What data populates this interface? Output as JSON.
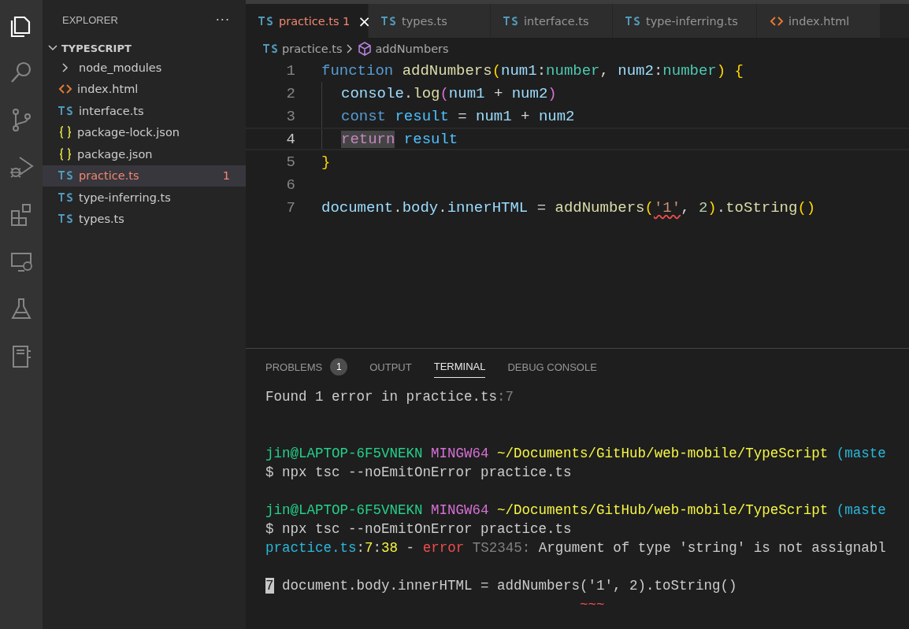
{
  "activity_bar": [
    {
      "kind": "files",
      "selected": true
    },
    {
      "kind": "search",
      "selected": false
    },
    {
      "kind": "branch",
      "selected": false
    },
    {
      "kind": "debug",
      "selected": false
    },
    {
      "kind": "extensions",
      "selected": false
    },
    {
      "kind": "remote",
      "selected": false
    },
    {
      "kind": "flask",
      "selected": false
    },
    {
      "kind": "notebook",
      "selected": false
    }
  ],
  "sidebar": {
    "title": "EXPLORER",
    "more": "···",
    "folder": {
      "label": "TYPESCRIPT",
      "expanded": true,
      "children": [
        {
          "label": "node_modules",
          "kind": "folder",
          "expanded": false,
          "selected": false,
          "error": false
        },
        {
          "label": "index.html",
          "kind": "html",
          "selected": false,
          "error": false
        },
        {
          "label": "interface.ts",
          "kind": "ts",
          "selected": false,
          "error": false
        },
        {
          "label": "package-lock.json",
          "kind": "json",
          "selected": false,
          "error": false
        },
        {
          "label": "package.json",
          "kind": "json",
          "selected": false,
          "error": false
        },
        {
          "label": "practice.ts",
          "kind": "ts",
          "selected": true,
          "error": true,
          "badge": "1"
        },
        {
          "label": "type-inferring.ts",
          "kind": "ts",
          "selected": false,
          "error": false
        },
        {
          "label": "types.ts",
          "kind": "ts",
          "selected": false,
          "error": false
        }
      ]
    }
  },
  "tabs": [
    {
      "label": "practice.ts",
      "kind": "ts",
      "selected": true,
      "error": true,
      "badge": "1",
      "close": "×"
    },
    {
      "label": "types.ts",
      "kind": "ts",
      "selected": false,
      "error": false
    },
    {
      "label": "interface.ts",
      "kind": "ts",
      "selected": false,
      "error": false
    },
    {
      "label": "type-inferring.ts",
      "kind": "ts",
      "selected": false,
      "error": false
    },
    {
      "label": "index.html",
      "kind": "html",
      "selected": false,
      "error": false
    }
  ],
  "breadcrumb": [
    {
      "label": "practice.ts",
      "kind": "ts"
    },
    {
      "label": "addNumbers",
      "kind": "symbol"
    }
  ],
  "editor": {
    "lines": [
      {
        "number": "1",
        "current": false,
        "indented": false,
        "tokens": [
          {
            "text": "function ",
            "kind": "keyword"
          },
          {
            "text": "addNumbers",
            "kind": "function"
          },
          {
            "text": "(",
            "kind": "bracket1"
          },
          {
            "text": "num1",
            "kind": "param"
          },
          {
            "text": ":",
            "kind": "plain"
          },
          {
            "text": "number",
            "kind": "type"
          },
          {
            "text": ", ",
            "kind": "plain"
          },
          {
            "text": "num2",
            "kind": "param"
          },
          {
            "text": ":",
            "kind": "plain"
          },
          {
            "text": "number",
            "kind": "type"
          },
          {
            "text": ") ",
            "kind": "bracket1"
          },
          {
            "text": "{",
            "kind": "bracket1"
          }
        ]
      },
      {
        "number": "2",
        "current": false,
        "indented": true,
        "tokens": [
          {
            "text": "console",
            "kind": "param"
          },
          {
            "text": ".",
            "kind": "plain"
          },
          {
            "text": "log",
            "kind": "function"
          },
          {
            "text": "(",
            "kind": "bracket2"
          },
          {
            "text": "num1",
            "kind": "param"
          },
          {
            "text": " + ",
            "kind": "plain"
          },
          {
            "text": "num2",
            "kind": "param"
          },
          {
            "text": ")",
            "kind": "bracket2"
          }
        ]
      },
      {
        "number": "3",
        "current": false,
        "indented": true,
        "tokens": [
          {
            "text": "const ",
            "kind": "keyword"
          },
          {
            "text": "result",
            "kind": "constant"
          },
          {
            "text": " = ",
            "kind": "plain"
          },
          {
            "text": "num1",
            "kind": "param"
          },
          {
            "text": " + ",
            "kind": "plain"
          },
          {
            "text": "num2",
            "kind": "param"
          }
        ]
      },
      {
        "number": "4",
        "current": true,
        "indented": true,
        "tokens": [
          {
            "text": "return",
            "kind": "control",
            "highlight": true
          },
          {
            "text": " result",
            "kind": "constant"
          }
        ]
      },
      {
        "number": "5",
        "current": false,
        "indented": false,
        "tokens": [
          {
            "text": "}",
            "kind": "bracket1"
          }
        ]
      },
      {
        "number": "6",
        "current": false,
        "indented": false
      },
      {
        "number": "7",
        "current": false,
        "indented": false,
        "tokens": [
          {
            "text": "document",
            "kind": "param"
          },
          {
            "text": ".",
            "kind": "plain"
          },
          {
            "text": "body",
            "kind": "param"
          },
          {
            "text": ".",
            "kind": "plain"
          },
          {
            "text": "innerHTML",
            "kind": "param"
          },
          {
            "text": " = ",
            "kind": "plain"
          },
          {
            "text": "addNumbers",
            "kind": "function"
          },
          {
            "text": "(",
            "kind": "bracket1"
          },
          {
            "text": "'1'",
            "kind": "string",
            "error": true
          },
          {
            "text": ", ",
            "kind": "plain"
          },
          {
            "text": "2",
            "kind": "number"
          },
          {
            "text": ")",
            "kind": "bracket1"
          },
          {
            "text": ".",
            "kind": "plain"
          },
          {
            "text": "toString",
            "kind": "function"
          },
          {
            "text": "()",
            "kind": "bracket1"
          }
        ]
      }
    ]
  },
  "panel": {
    "tabs": [
      {
        "label": "PROBLEMS",
        "selected": false,
        "badge": "1"
      },
      {
        "label": "OUTPUT",
        "selected": false
      },
      {
        "label": "TERMINAL",
        "selected": true
      },
      {
        "label": "DEBUG CONSOLE",
        "selected": false
      }
    ],
    "terminal": [
      {
        "kind": "text",
        "segments": [
          {
            "text": "Found 1 error in practice.ts",
            "kind": "plain"
          },
          {
            "text": ":7",
            "kind": "dim"
          }
        ]
      },
      {
        "kind": "blank"
      },
      {
        "kind": "blank"
      },
      {
        "kind": "text",
        "segments": [
          {
            "text": "jin@LAPTOP-6F5VNEKN ",
            "kind": "green"
          },
          {
            "text": "MINGW64 ",
            "kind": "magenta"
          },
          {
            "text": "~/Documents/GitHub/web-mobile/TypeScript ",
            "kind": "yellow"
          },
          {
            "text": "(maste",
            "kind": "cyan"
          }
        ]
      },
      {
        "kind": "text",
        "segments": [
          {
            "text": "$ npx tsc --noEmitOnError practice.ts",
            "kind": "plain"
          }
        ]
      },
      {
        "kind": "blank"
      },
      {
        "kind": "text",
        "segments": [
          {
            "text": "jin@LAPTOP-6F5VNEKN ",
            "kind": "green"
          },
          {
            "text": "MINGW64 ",
            "kind": "magenta"
          },
          {
            "text": "~/Documents/GitHub/web-mobile/TypeScript ",
            "kind": "yellow"
          },
          {
            "text": "(maste",
            "kind": "cyan"
          }
        ]
      },
      {
        "kind": "text",
        "segments": [
          {
            "text": "$ npx tsc --noEmitOnError practice.ts",
            "kind": "plain"
          }
        ]
      },
      {
        "kind": "text",
        "segments": [
          {
            "text": "practice.ts",
            "kind": "cyan"
          },
          {
            "text": ":",
            "kind": "plain"
          },
          {
            "text": "7",
            "kind": "yellow"
          },
          {
            "text": ":",
            "kind": "plain"
          },
          {
            "text": "38",
            "kind": "yellow"
          },
          {
            "text": " - ",
            "kind": "plain"
          },
          {
            "text": "error ",
            "kind": "red"
          },
          {
            "text": "TS2345:",
            "kind": "dim"
          },
          {
            "text": " Argument of type 'string' is not assignabl",
            "kind": "plain"
          }
        ]
      },
      {
        "kind": "blank"
      },
      {
        "kind": "text",
        "segments": [
          {
            "text": "7",
            "kind": "gutter"
          },
          {
            "text": " document.body.innerHTML = addNumbers('1', 2).toString()",
            "kind": "plain"
          }
        ]
      },
      {
        "kind": "text",
        "segments": [
          {
            "text": "                                      ~~~",
            "kind": "red"
          }
        ]
      }
    ]
  }
}
